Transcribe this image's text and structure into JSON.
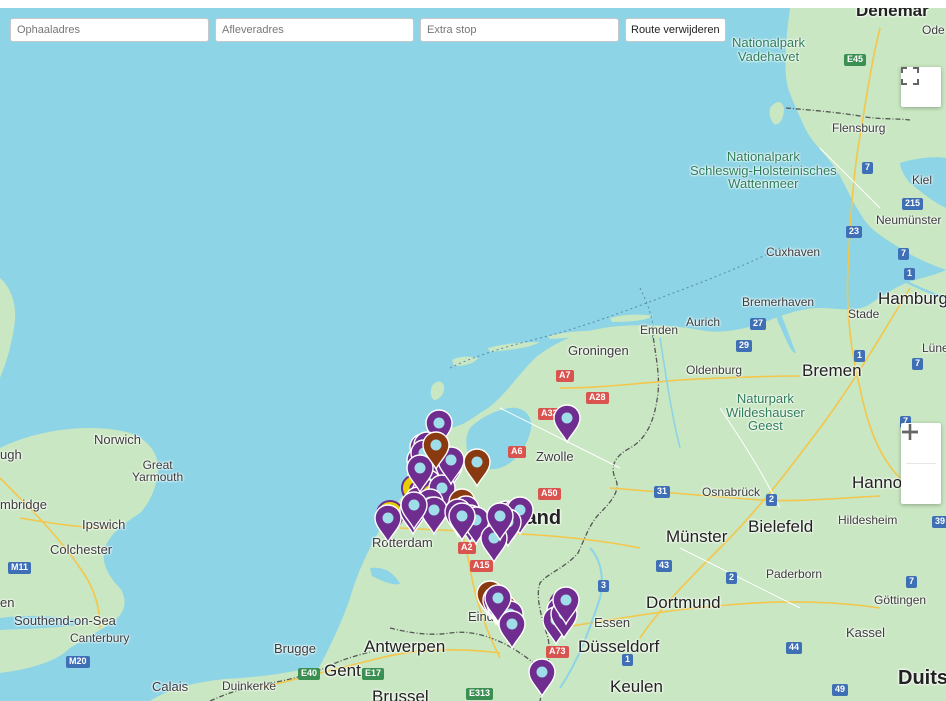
{
  "search": {
    "pickup_placeholder": "Ophaaladres",
    "dropoff_placeholder": "Afleveradres",
    "extra_stop_placeholder": "Extra stop",
    "remove_route_label": "Route verwijderen"
  },
  "controls": {
    "fullscreen_icon": "fullscreen-icon",
    "zoom_in_icon": "plus-icon",
    "zoom_out_icon": "minus-icon"
  },
  "colors": {
    "water": "#8cd4e6",
    "land": "#c9e7c2",
    "marker_purple": "#6f2d8f",
    "marker_brown": "#8a3a10",
    "marker_yellow": "#e6d000"
  },
  "labels": {
    "denmark": "Denemar",
    "odense": "Ode",
    "np_vadehavet": "Nationalpark\nVadehavet",
    "flensburg": "Flensburg",
    "np_sh": "Nationalpark\nSchleswig-Holsteinisches\nWattenmeer",
    "kiel": "Kiel",
    "neumunster": "Neumünster",
    "cuxhaven": "Cuxhaven",
    "bremerhaven": "Bremerhaven",
    "hamburg": "Hamburg",
    "stade": "Stade",
    "emden": "Emden",
    "aurich": "Aurich",
    "groningen": "Groningen",
    "oldenburg": "Oldenburg",
    "bremen": "Bremen",
    "lune": "Lüne",
    "np_wildeshauser": "Naturpark\nWildeshauser\nGeest",
    "norwich": "Norwich",
    "great_yarmouth": "Great\nYarmouth",
    "zwolle": "Zwolle",
    "hannover": "Hanno",
    "osnabruck": "Osnabrück",
    "cambridge": "mbridge",
    "ipswich": "Ipswich",
    "bielefeld": "Bielefeld",
    "hildesheim": "Hildesheim",
    "nederland": "land",
    "rotterdam": "Rotterdam",
    "colchester": "Colchester",
    "munster": "Münster",
    "paderborn": "Paderborn",
    "london": "en",
    "southend": "Southend-on-Sea",
    "canterbury": "Canterbury",
    "dortmund": "Dortmund",
    "essen": "Essen",
    "eindhoven": "Eind",
    "gottingen": "Göttingen",
    "brugge": "Brugge",
    "antwerpen": "Antwerpen",
    "dusseldorf": "Düsseldorf",
    "kassel": "Kassel",
    "gent": "Gent",
    "calais": "Calais",
    "duinkerke": "Duinkerke",
    "brussel": "Brussel",
    "keulen": "Keulen",
    "duitsland": "Duits",
    "ugh": "ugh"
  },
  "road_shields": {
    "e45": "E45",
    "n7a": "7",
    "n215": "215",
    "n23": "23",
    "n7b": "7",
    "n1a": "1",
    "n27": "27",
    "n29": "29",
    "n1b": "1",
    "n7c": "7",
    "a7": "A7",
    "a28": "A28",
    "a32": "A32",
    "a6": "A6",
    "a50": "A50",
    "n31": "31",
    "n2a": "2",
    "n39": "39",
    "a2": "A2",
    "a15": "A15",
    "n43": "43",
    "n2b": "2",
    "n3": "3",
    "m11": "M11",
    "m20": "M20",
    "a73": "A73",
    "e40": "E40",
    "e17": "E17",
    "e313": "E313",
    "n49": "49",
    "n44": "44",
    "n7d": "7",
    "n1c": "1",
    "n7e": "7"
  },
  "markers": {
    "count_visible": 52
  }
}
